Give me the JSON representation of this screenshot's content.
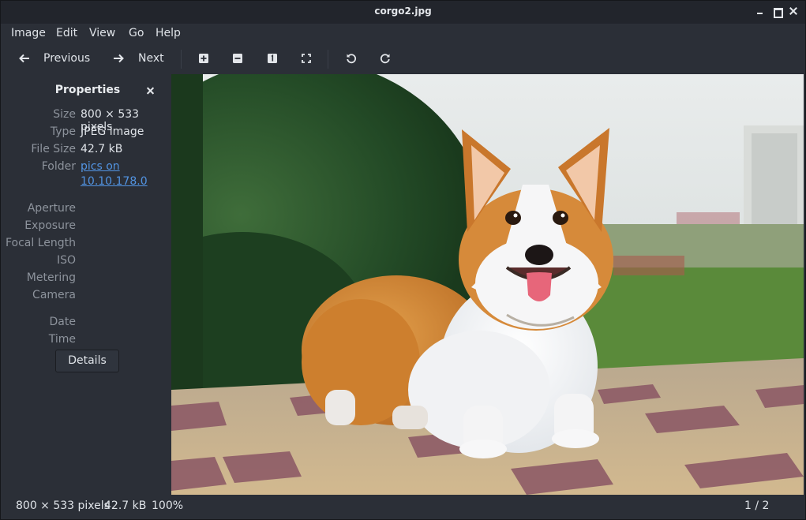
{
  "window": {
    "title": "corgo2.jpg"
  },
  "menu": {
    "image": "Image",
    "edit": "Edit",
    "view": "View",
    "go": "Go",
    "help": "Help"
  },
  "toolbar": {
    "previous": "Previous",
    "next": "Next"
  },
  "properties": {
    "title": "Properties",
    "size_label": "Size",
    "size_value": "800 × 533 pixels",
    "type_label": "Type",
    "type_value": "JPEG image",
    "filesize_label": "File Size",
    "filesize_value": "42.7 kB",
    "folder_label": "Folder",
    "folder_line1": "pics on",
    "folder_line2": "10.10.178.0",
    "aperture_label": "Aperture",
    "exposure_label": "Exposure",
    "focal_label": "Focal Length",
    "iso_label": "ISO",
    "metering_label": "Metering",
    "camera_label": "Camera",
    "date_label": "Date",
    "time_label": "Time",
    "details_button": "Details"
  },
  "status": {
    "dimensions": "800 × 533 pixels",
    "filesize": "42.7 kB",
    "zoom": "100%",
    "position": "1 / 2"
  },
  "colors": {
    "background": "#2b2f37",
    "titlebar": "#22252c",
    "label": "#8d939c",
    "link": "#5294e2"
  },
  "icons": [
    "arrow-left-icon",
    "arrow-right-icon",
    "zoom-in-icon",
    "zoom-out-icon",
    "normal-size-icon",
    "best-fit-icon",
    "rotate-left-icon",
    "rotate-right-icon",
    "close-icon"
  ]
}
